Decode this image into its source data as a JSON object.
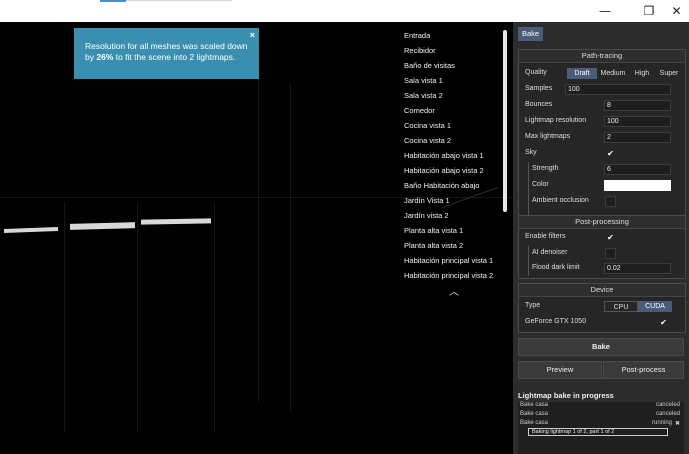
{
  "window": {
    "minimize_icon": "minimize-icon",
    "maximize_icon": "restore-icon",
    "close_icon": "close-icon",
    "minimize_glyph": "—",
    "restore_glyph": "❐",
    "close_glyph": "✕"
  },
  "notice": {
    "text_before": "Resolution for all meshes was scaled down by ",
    "percent": "26%",
    "text_after": " to fit the scene into 2 lightmaps.",
    "close_glyph": "×",
    "color": "#3a8fb0"
  },
  "views": {
    "items": [
      "Entrada",
      "Recibidor",
      "Baño de visitas",
      "Sala vista 1",
      "Sala vista 2",
      "Comedor",
      "Cocina vista 1",
      "Cocina vista 2",
      "Habitación abajo vista 1",
      "Habitación abajo vista 2",
      "Baño Habitación abajo",
      "Jardín Vista 1",
      "Jardín vista 2",
      "Planta alta vista 1",
      "Planta alta vista 2",
      "Habitación principal vista 1",
      "Habitación principal vista 2"
    ],
    "collapse_glyph": "︿"
  },
  "panel": {
    "tab_label": "Bake",
    "accent": "#4a5c79",
    "path_tracing": {
      "title": "Path-tracing",
      "quality_label": "Quality",
      "quality_options": [
        "Draft",
        "Medium",
        "High",
        "Super"
      ],
      "quality_selected": "Draft",
      "samples_label": "Samples",
      "samples_value": "100",
      "bounces_label": "Bounces",
      "bounces_value": "8",
      "lightmap_res_label": "Lightmap resolution",
      "lightmap_res_value": "100",
      "max_lightmaps_label": "Max lightmaps",
      "max_lightmaps_value": "2",
      "sky_label": "Sky",
      "sky_checked": "✔",
      "strength_label": "Strength",
      "strength_value": "6",
      "color_label": "Color",
      "color_value": "#ffffff",
      "ao_label": "Ambient occlusion"
    },
    "post_processing": {
      "title": "Post-processing",
      "enable_label": "Enable filters",
      "enable_checked": "✔",
      "denoiser_label": "AI denoiser",
      "flood_label": "Flood dark limit",
      "flood_value": "0.02"
    },
    "device": {
      "title": "Device",
      "type_label": "Type",
      "type_options": [
        "CPU",
        "CUDA"
      ],
      "type_selected": "CUDA",
      "gpu_label": "GeForce GTX 1050",
      "gpu_checked": "✔"
    },
    "bake_button": "Bake",
    "preview_button": "Preview",
    "postprocess_button": "Post-process",
    "log": {
      "title": "Lightmap bake in progress",
      "entries": [
        {
          "name": "Bake casa",
          "status": "canceled"
        },
        {
          "name": "Bake casa",
          "status": "canceled"
        },
        {
          "name": "Bake casa",
          "status": "running",
          "cancel_glyph": "✖"
        }
      ],
      "progress_text": "Baking lightmap 1 of 2, part 1 of 2"
    }
  }
}
